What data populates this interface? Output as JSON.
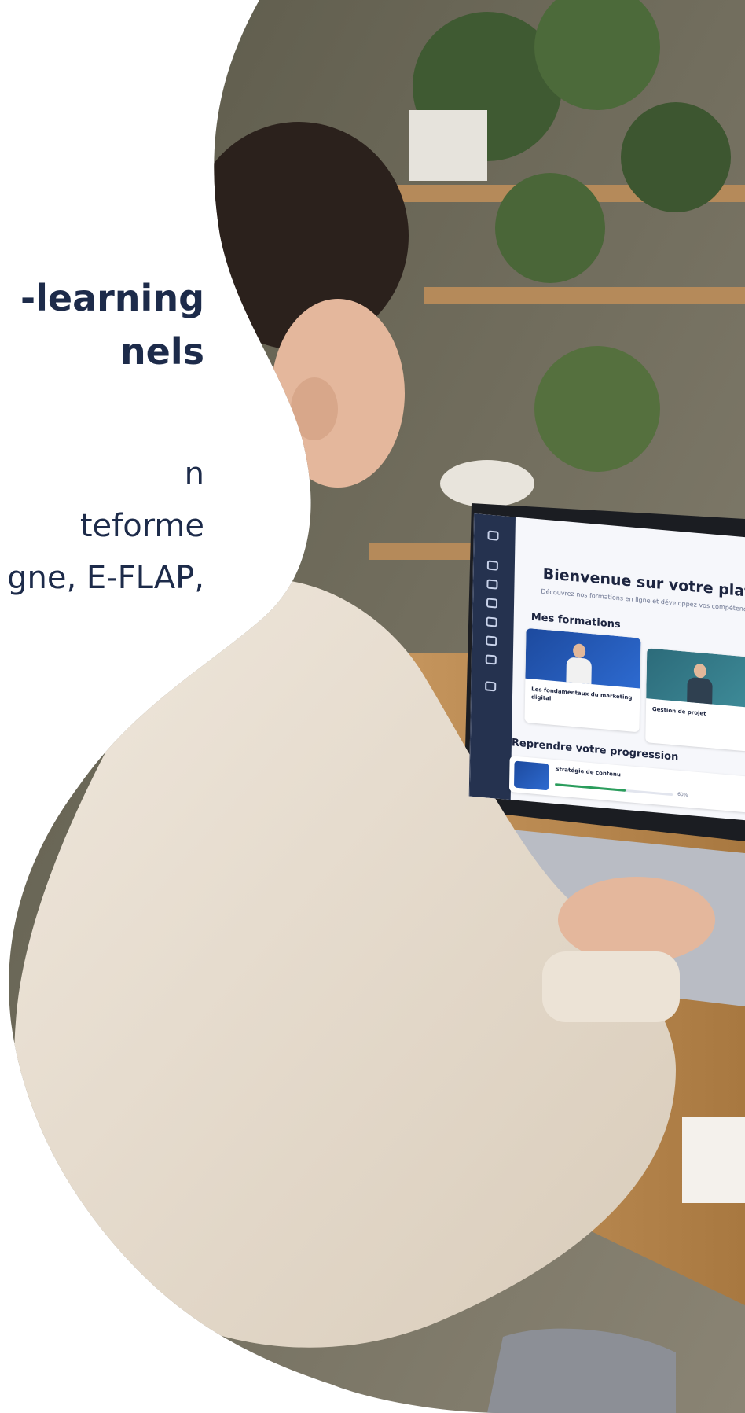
{
  "hero": {
    "title_lines": [
      "-learning",
      "nels"
    ],
    "body_lines": [
      "n",
      "teforme",
      "gne, E-FLAP,"
    ]
  },
  "photo": {
    "alt": "Woman in a cream knit sweater using a laptop at a wooden desk with plants in the background"
  },
  "screen": {
    "welcome": "Bienvenue sur votre plateforme de",
    "welcome_sub": "Découvrez nos formations en ligne et développez vos compétences à v",
    "section_formations": "Mes formations",
    "cards": [
      {
        "title": "Les fondamentaux du marketing digital",
        "meta": "",
        "button": ""
      },
      {
        "title": "Gestion de projet",
        "meta": "",
        "button": ""
      }
    ],
    "section_progress": "Reprendre votre progression",
    "progress": {
      "title": "Stratégie de contenu",
      "fraction": 0.6,
      "label": "60%"
    }
  },
  "colors": {
    "text_dark": "#1d2b4a",
    "sidebar": "#25324f",
    "accent_green": "#2b9d5c"
  }
}
